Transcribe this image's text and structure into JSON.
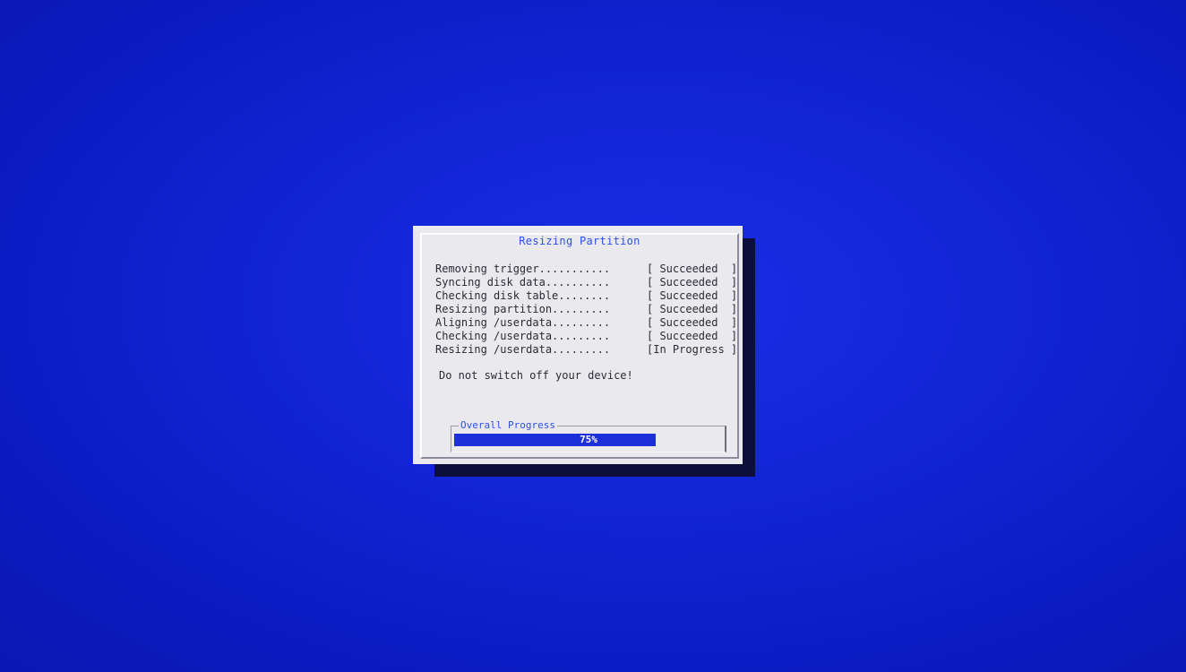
{
  "dialog": {
    "title": "Resizing Partition",
    "steps": [
      {
        "label": "Removing trigger...........",
        "status": "[ Succeeded  ]"
      },
      {
        "label": "Syncing disk data..........",
        "status": "[ Succeeded  ]"
      },
      {
        "label": "Checking disk table........",
        "status": "[ Succeeded  ]"
      },
      {
        "label": "Resizing partition.........",
        "status": "[ Succeeded  ]"
      },
      {
        "label": "Aligning /userdata.........",
        "status": "[ Succeeded  ]"
      },
      {
        "label": "Checking /userdata.........",
        "status": "[ Succeeded  ]"
      },
      {
        "label": "Resizing /userdata.........",
        "status": "[In Progress ]"
      }
    ],
    "warning": "Do not switch off your device!",
    "progress": {
      "title": "Overall Progress",
      "percent": 75,
      "label": "75%"
    }
  },
  "colors": {
    "background": "#1326d6",
    "dialog_bg": "#e9e9ee",
    "accent": "#2f4ee8",
    "progress_fill": "#1c2fd9",
    "text": "#2b2b33"
  }
}
